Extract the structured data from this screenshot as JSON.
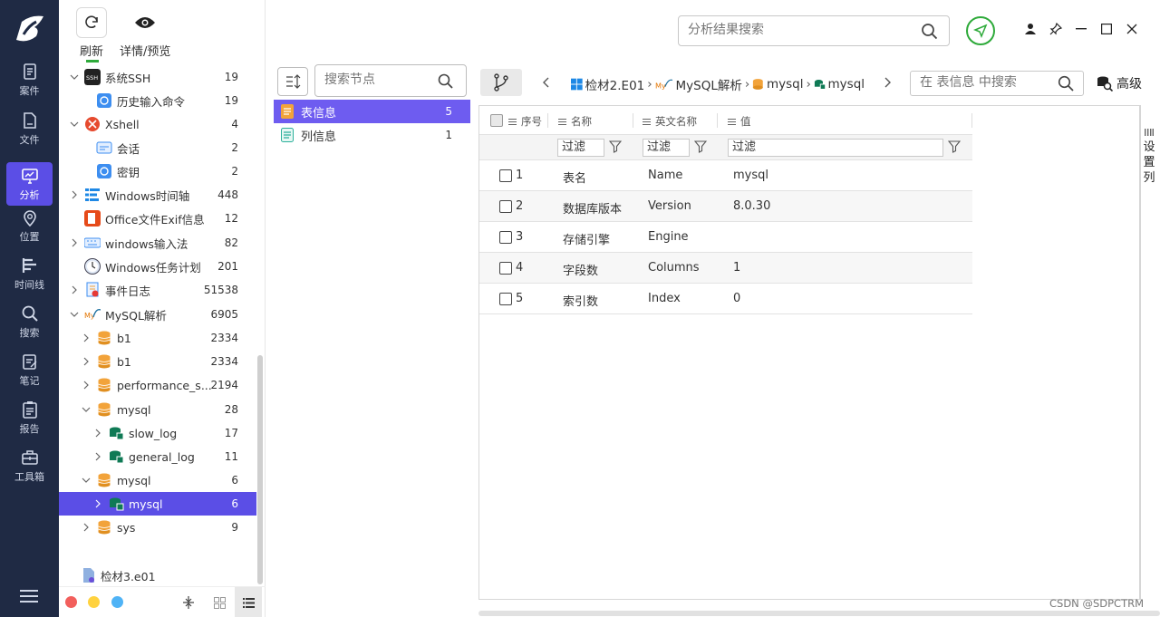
{
  "toolbar": {
    "refresh_label": "刷新",
    "details_label": "详情/预览"
  },
  "rail": [
    {
      "label": "案件",
      "icon": "case-icon"
    },
    {
      "label": "文件",
      "icon": "file-icon"
    },
    {
      "label": "分析",
      "icon": "analysis-icon",
      "active": true
    },
    {
      "label": "位置",
      "icon": "location-icon"
    },
    {
      "label": "时间线",
      "icon": "timeline-icon"
    },
    {
      "label": "搜索",
      "icon": "search-icon"
    },
    {
      "label": "笔记",
      "icon": "note-icon"
    },
    {
      "label": "报告",
      "icon": "report-icon"
    },
    {
      "label": "工具箱",
      "icon": "toolbox-icon"
    }
  ],
  "tree": [
    {
      "label": "系统SSH",
      "count": "19"
    },
    {
      "label": "历史输入命令",
      "count": "19"
    },
    {
      "label": "Xshell",
      "count": "4"
    },
    {
      "label": "会话",
      "count": "2"
    },
    {
      "label": "密钥",
      "count": "2"
    },
    {
      "label": "Windows时间轴",
      "count": "448"
    },
    {
      "label": "Office文件Exif信息",
      "count": "12"
    },
    {
      "label": "windows输入法",
      "count": "82"
    },
    {
      "label": "Windows任务计划",
      "count": "201"
    },
    {
      "label": "事件日志",
      "count": "51538"
    },
    {
      "label": "MySQL解析",
      "count": "6905"
    },
    {
      "label": "b1",
      "count": "2334"
    },
    {
      "label": "b1",
      "count": "2334"
    },
    {
      "label": "performance_s...",
      "count": "2194"
    },
    {
      "label": "mysql",
      "count": "28"
    },
    {
      "label": "slow_log",
      "count": "17"
    },
    {
      "label": "general_log",
      "count": "11"
    },
    {
      "label": "mysql",
      "count": "6"
    },
    {
      "label": "mysql",
      "count": "6"
    },
    {
      "label": "sys",
      "count": "9"
    }
  ],
  "tree_footer_item": "检材3.e01",
  "node_search_placeholder": "搜索节点",
  "nodes": [
    {
      "label": "表信息",
      "count": "5"
    },
    {
      "label": "列信息",
      "count": "1"
    }
  ],
  "top_search_placeholder": "分析结果搜索",
  "breadcrumb": {
    "item1": "检材2.E01",
    "item2": "MySQL解析",
    "item3": "mysql",
    "item4": "mysql"
  },
  "table_search_placeholder": "在 表信息 中搜索",
  "advanced_label": "高级",
  "columns": {
    "seq": "序号",
    "name": "名称",
    "en_name": "英文名称",
    "value": "值"
  },
  "filter_label": "过滤",
  "rows": [
    {
      "seq": "1",
      "name": "表名",
      "en": "Name",
      "value": "mysql"
    },
    {
      "seq": "2",
      "name": "数据库版本",
      "en": "Version",
      "value": "8.0.30"
    },
    {
      "seq": "3",
      "name": "存储引擎",
      "en": "Engine",
      "value": ""
    },
    {
      "seq": "4",
      "name": "字段数",
      "en": "Columns",
      "value": "1"
    },
    {
      "seq": "5",
      "name": "索引数",
      "en": "Index",
      "value": "0"
    }
  ],
  "set_columns_label": "设置列",
  "watermark": "CSDN @SDPCTRM",
  "colors": {
    "rail_bg": "#1f2a44",
    "accent": "#5b4ee6",
    "green": "#2eaa3a"
  }
}
